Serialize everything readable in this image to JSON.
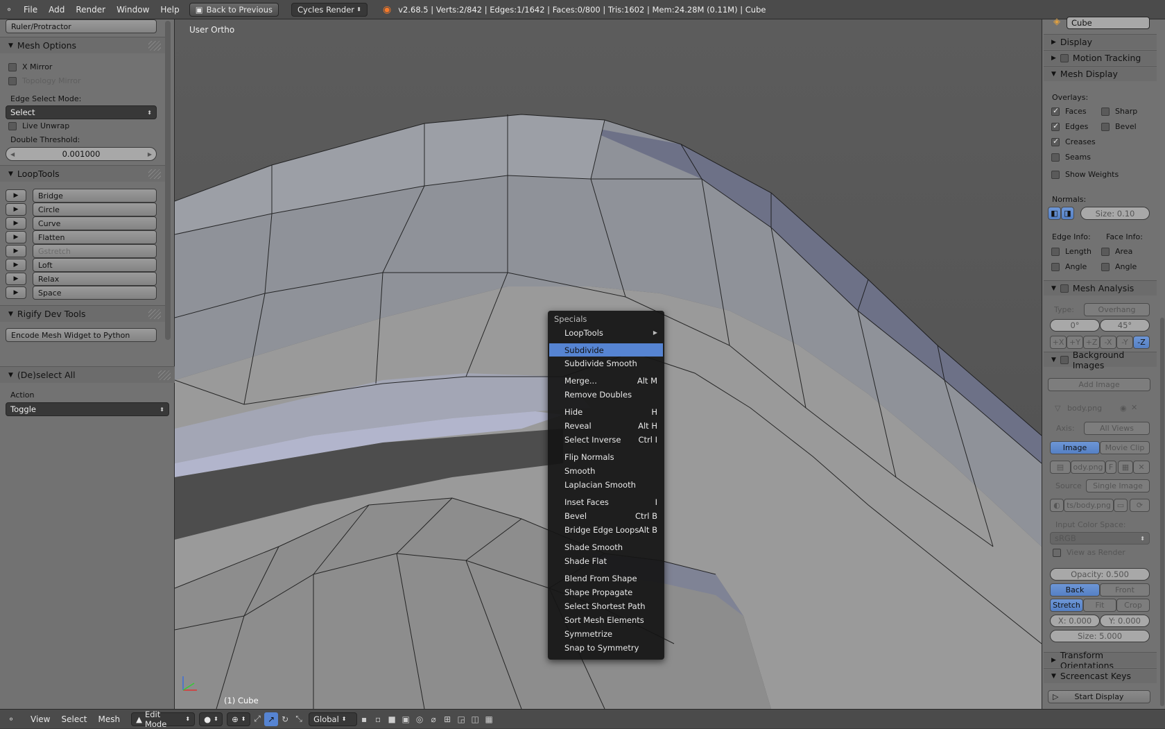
{
  "topbar": {
    "menus": [
      "File",
      "Add",
      "Render",
      "Window",
      "Help"
    ],
    "back_button": "Back to Previous",
    "render_engine": "Cycles Render",
    "stats": "v2.68.5 | Verts:2/842 | Edges:1/1642 | Faces:0/800 | Tris:1602 | Mem:24.28M (0.11M) | Cube"
  },
  "left": {
    "ruler_button": "Ruler/Protractor",
    "mesh_options": {
      "title": "Mesh Options",
      "x_mirror": "X Mirror",
      "topology_mirror": "Topology Mirror",
      "edge_select_mode_label": "Edge Select Mode:",
      "edge_select_mode_value": "Select",
      "live_unwrap": "Live Unwrap",
      "double_threshold_label": "Double Threshold:",
      "double_threshold_value": "0.001000"
    },
    "looptools": {
      "title": "LoopTools",
      "items": [
        "Bridge",
        "Circle",
        "Curve",
        "Flatten",
        "Gstretch",
        "Loft",
        "Relax",
        "Space"
      ]
    },
    "rigify": {
      "title": "Rigify Dev Tools",
      "button": "Encode Mesh Widget to Python"
    },
    "deselect": {
      "title": "(De)select All",
      "action_label": "Action",
      "action_value": "Toggle"
    }
  },
  "viewport": {
    "view_label": "User Ortho",
    "object_label": "(1) Cube"
  },
  "specials_menu": {
    "title": "Specials",
    "items": [
      {
        "label": "LoopTools",
        "shortcut": ""
      },
      {
        "label": "Subdivide",
        "shortcut": ""
      },
      {
        "label": "Subdivide Smooth",
        "shortcut": ""
      },
      {
        "label": "Merge...",
        "shortcut": "Alt M"
      },
      {
        "label": "Remove Doubles",
        "shortcut": ""
      },
      {
        "label": "Hide",
        "shortcut": "H"
      },
      {
        "label": "Reveal",
        "shortcut": "Alt H"
      },
      {
        "label": "Select Inverse",
        "shortcut": "Ctrl I"
      },
      {
        "label": "Flip Normals",
        "shortcut": ""
      },
      {
        "label": "Smooth",
        "shortcut": ""
      },
      {
        "label": "Laplacian Smooth",
        "shortcut": ""
      },
      {
        "label": "Inset Faces",
        "shortcut": "I"
      },
      {
        "label": "Bevel",
        "shortcut": "Ctrl B"
      },
      {
        "label": "Bridge Edge Loops",
        "shortcut": "Alt B"
      },
      {
        "label": "Shade Smooth",
        "shortcut": ""
      },
      {
        "label": "Shade Flat",
        "shortcut": ""
      },
      {
        "label": "Blend From Shape",
        "shortcut": ""
      },
      {
        "label": "Shape Propagate",
        "shortcut": ""
      },
      {
        "label": "Select Shortest Path",
        "shortcut": ""
      },
      {
        "label": "Sort Mesh Elements",
        "shortcut": ""
      },
      {
        "label": "Symmetrize",
        "shortcut": ""
      },
      {
        "label": "Snap to Symmetry",
        "shortcut": ""
      }
    ]
  },
  "right": {
    "object_name": "Cube",
    "display": "Display",
    "motion_tracking": "Motion Tracking",
    "mesh_display": {
      "title": "Mesh Display",
      "overlays_label": "Overlays:",
      "faces": "Faces",
      "sharp": "Sharp",
      "edges": "Edges",
      "bevel": "Bevel",
      "creases": "Creases",
      "seams": "Seams",
      "show_weights": "Show Weights",
      "normals_label": "Normals:",
      "normals_size": "Size: 0.10",
      "edge_info_label": "Edge Info:",
      "face_info_label": "Face Info:",
      "length": "Length",
      "area": "Area",
      "angle_edge": "Angle",
      "angle_face": "Angle"
    },
    "mesh_analysis": {
      "title": "Mesh Analysis",
      "type_label": "Type:",
      "type_value": "Overhang",
      "min": "0°",
      "max": "45°",
      "axes": [
        "+X",
        "+Y",
        "+Z",
        "-X",
        "-Y",
        "-Z"
      ]
    },
    "background_images": {
      "title": "Background Images",
      "add_image": "Add Image",
      "image_name": "body.png",
      "axis_label": "Axis:",
      "axis_value": "All Views",
      "tab_image": "Image",
      "tab_movie": "Movie Clip",
      "file_short": "ody.png",
      "file_flag": "F",
      "source_label": "Source",
      "source_value": "Single Image",
      "path": "ts/body.png",
      "color_space_label": "Input Color Space:",
      "color_space_value": "sRGB",
      "view_as_render": "View as Render",
      "opacity": "Opacity: 0.500",
      "back": "Back",
      "front": "Front",
      "stretch": "Stretch",
      "fit": "Fit",
      "crop": "Crop",
      "x": "X: 0.000",
      "y": "Y: 0.000",
      "size": "Size: 5.000"
    },
    "transform_orientations": "Transform Orientations",
    "screencast_keys": "Screencast Keys",
    "start_display": "Start Display"
  },
  "bottombar": {
    "menus": [
      "View",
      "Select",
      "Mesh"
    ],
    "mode": "Edit Mode",
    "orientation": "Global"
  },
  "colors": {
    "accent": "#5684d2",
    "menu_bg": "#141414",
    "panel": "#727272"
  }
}
